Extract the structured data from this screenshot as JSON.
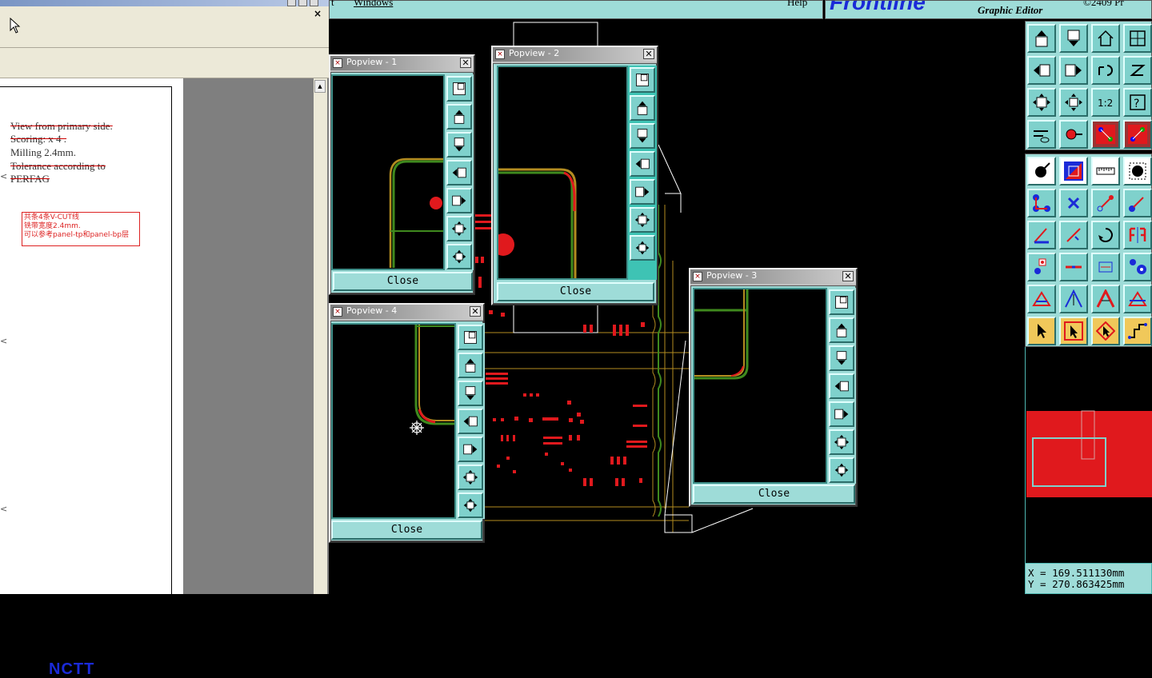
{
  "document": {
    "notes": [
      "View from primary side.",
      "Scoring:  x 4 .",
      "Milling 2.4mm.",
      "Tolerance according to",
      "PERFAG"
    ],
    "cn_note": [
      "共条4条V-CUT线",
      "铣带宽度2.4mm.",
      "可以参考panel-tp和panel-bp层"
    ],
    "close_glyph": "×",
    "logo_text": "NCTT"
  },
  "menu": {
    "items": [
      "t",
      "Windows",
      "Help"
    ]
  },
  "brand": {
    "logo": "Frontline",
    "subtitle": "Graphic Editor",
    "code": "©2409 Pr"
  },
  "popviews": [
    {
      "title": "Popview - 1",
      "close_label": "Close",
      "x_glyph": "✕"
    },
    {
      "title": "Popview - 2",
      "close_label": "Close",
      "x_glyph": "✕"
    },
    {
      "title": "Popview - 3",
      "close_label": "Close",
      "x_glyph": "✕"
    },
    {
      "title": "Popview - 4",
      "close_label": "Close",
      "x_glyph": "✕"
    }
  ],
  "popview_tools": [
    "zoom-window-icon",
    "pan-up-icon",
    "pan-down-icon",
    "pan-left-icon",
    "pan-right-icon",
    "zoom-out-icon",
    "zoom-in-icon"
  ],
  "palette": {
    "tools": [
      "pan-up-icon",
      "pan-down-icon",
      "home-icon",
      "window-icon",
      "pan-left-icon",
      "pan-right-icon",
      "undo-view-icon",
      "redraw-icon",
      "fit-icon",
      "zoom-all-icon",
      "scale-icon",
      "help-icon",
      "measure-tool-icon",
      "probe-icon",
      "layers-a-icon",
      "layers-b-icon",
      "select-pad-icon",
      "color-icon",
      "ruler-icon",
      "pad-icon",
      "connect-icon",
      "cross-icon",
      "line-icon",
      "arc-icon",
      "angle-icon",
      "slope-icon",
      "rotate-icon",
      "mirror-icon",
      "move-icon",
      "horiz-line-icon",
      "dimension-icon",
      "group-icon",
      "triangle-a-icon",
      "triangle-b-icon",
      "triangle-c-icon",
      "triangle-d-icon",
      "pointer-icon",
      "pointer-box-icon",
      "pointer-rotate-icon",
      "path-icon"
    ]
  },
  "coords": {
    "x": "X = 169.511130mm",
    "y": "Y = 270.863425mm"
  },
  "colors": {
    "panel": "#9edcd8",
    "canvas": "#000000",
    "copper": "#e0191d",
    "outline": "#b38c20",
    "route": "#3f8a1e"
  }
}
